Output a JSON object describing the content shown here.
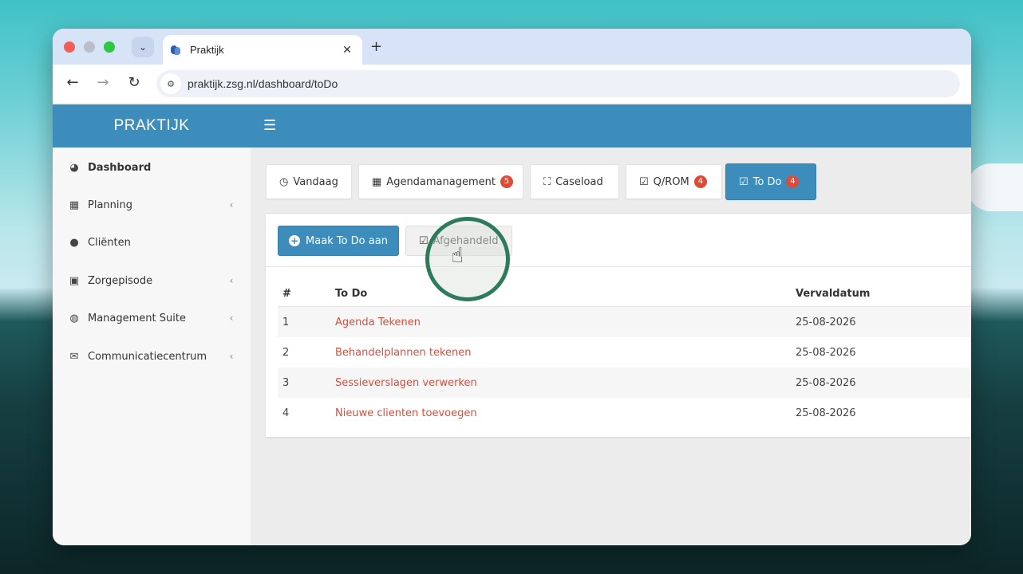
{
  "browser": {
    "tab_title": "Praktijk",
    "url": "praktijk.zsg.nl/dashboard/toDo",
    "new_tab_symbol": "+",
    "close_symbol": "✕"
  },
  "app": {
    "brand": "PRAKTIJK",
    "header_color": "#3c8dbc"
  },
  "sidebar": {
    "items": [
      {
        "label": "Dashboard",
        "icon": "dashboard-icon"
      },
      {
        "label": "Planning",
        "icon": "calendar-icon"
      },
      {
        "label": "Cliënten",
        "icon": "user-icon"
      },
      {
        "label": "Zorgepisode",
        "icon": "medkit-icon"
      },
      {
        "label": "Management Suite",
        "icon": "globe-icon"
      },
      {
        "label": "Communicatiecentrum",
        "icon": "envelope-icon"
      }
    ]
  },
  "tabs": [
    {
      "label": "Vandaag",
      "icon": "clock-icon",
      "badge": ""
    },
    {
      "label": "Agendamanagement",
      "icon": "calendar-icon",
      "badge": "5"
    },
    {
      "label": "Caseload",
      "icon": "crop-icon",
      "badge": ""
    },
    {
      "label": "Q/ROM",
      "icon": "check-square-icon",
      "badge": "4"
    },
    {
      "label": "To Do",
      "icon": "check-square-icon",
      "badge": "4",
      "active": true
    }
  ],
  "actions": {
    "create_label": "Maak To Do aan",
    "done_label": "Afgehandeld"
  },
  "table": {
    "headers": [
      "#",
      "To Do",
      "Vervaldatum"
    ],
    "rows": [
      {
        "num": "1",
        "todo": "Agenda Tekenen",
        "due": "25-08-2026"
      },
      {
        "num": "2",
        "todo": "Behandelplannen tekenen",
        "due": "25-08-2026"
      },
      {
        "num": "3",
        "todo": "Sessieverslagen verwerken",
        "due": "25-08-2026"
      },
      {
        "num": "4",
        "todo": "Nieuwe clienten toevoegen",
        "due": "25-08-2026"
      }
    ]
  },
  "colors": {
    "primary": "#3c8dbc",
    "badge": "#dd4b39",
    "link": "#dd4b39",
    "highlight_ring": "#2e7a5c"
  }
}
